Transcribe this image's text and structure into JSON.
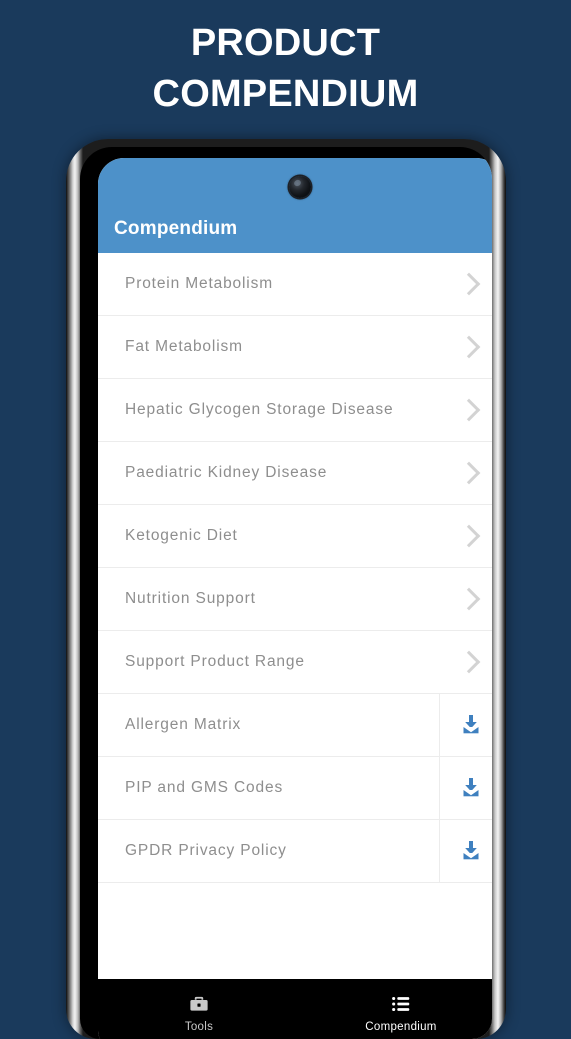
{
  "promo": {
    "title": "PRODUCT\nCOMPENDIUM"
  },
  "colors": {
    "page_background": "#1a3a5c",
    "appbar": "#4d91c9",
    "download_icon": "#3f80bf",
    "chevron": "#d3d3d3",
    "row_text": "#8e8e8e",
    "nav_background": "#000000"
  },
  "app": {
    "appbar": {
      "title": "Compendium",
      "camera_icon": "camera-punch-hole"
    },
    "list": [
      {
        "label": "Protein Metabolism",
        "action": "chevron-right-icon"
      },
      {
        "label": "Fat Metabolism",
        "action": "chevron-right-icon"
      },
      {
        "label": "Hepatic Glycogen Storage Disease",
        "action": "chevron-right-icon"
      },
      {
        "label": "Paediatric Kidney Disease",
        "action": "chevron-right-icon"
      },
      {
        "label": "Ketogenic Diet",
        "action": "chevron-right-icon"
      },
      {
        "label": "Nutrition Support",
        "action": "chevron-right-icon"
      },
      {
        "label": "Support Product Range",
        "action": "chevron-right-icon"
      },
      {
        "label": "Allergen Matrix",
        "action": "download-icon"
      },
      {
        "label": "PIP and GMS Codes",
        "action": "download-icon"
      },
      {
        "label": "GPDR Privacy Policy",
        "action": "download-icon"
      }
    ],
    "bottom_nav": [
      {
        "label": "Tools",
        "icon": "briefcase-icon",
        "active": false
      },
      {
        "label": "Compendium",
        "icon": "list-icon",
        "active": true
      }
    ]
  }
}
